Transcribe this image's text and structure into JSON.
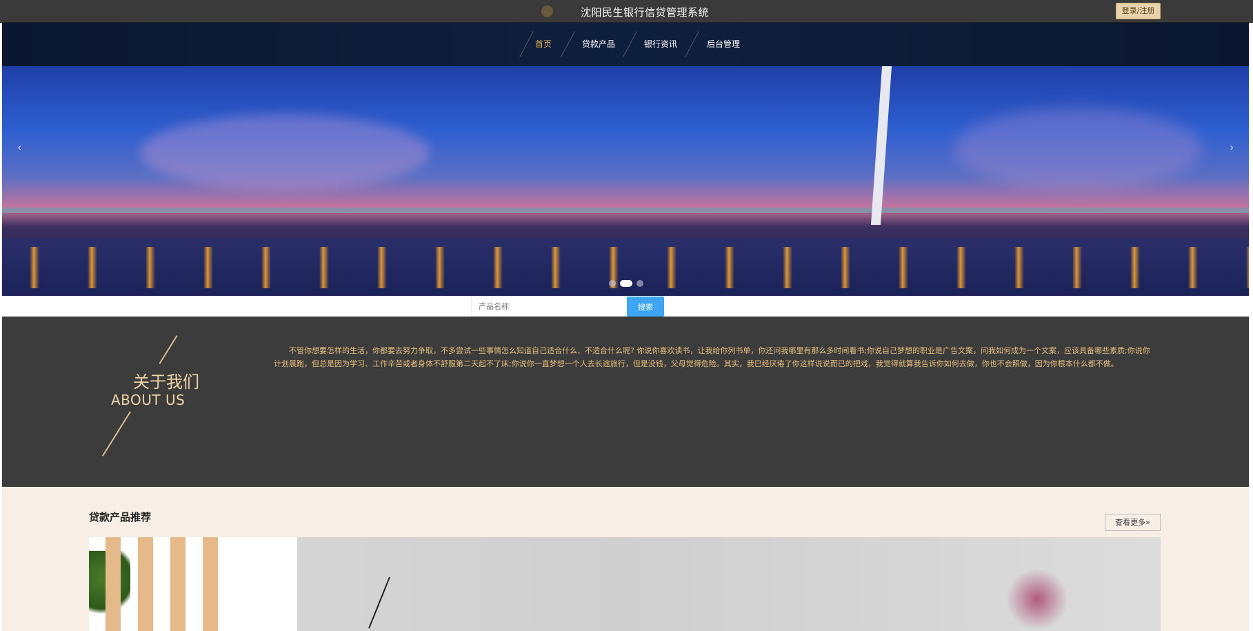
{
  "header": {
    "site_title": "沈阳民生银行信贷管理系统",
    "login_label": "登录/注册"
  },
  "nav": {
    "items": [
      {
        "label": "首页",
        "active": true
      },
      {
        "label": "贷款产品",
        "active": false
      },
      {
        "label": "银行资讯",
        "active": false
      },
      {
        "label": "后台管理",
        "active": false
      }
    ]
  },
  "banner": {
    "prev_icon": "chevron-left-icon",
    "next_icon": "chevron-right-icon",
    "slide_count": 3,
    "active_slide": 2
  },
  "search": {
    "placeholder": "产品名称",
    "button_label": "搜索"
  },
  "about": {
    "title_cn": "关于我们",
    "title_en": "ABOUT US",
    "text": "不管你想要怎样的生活，你都要去努力争取，不多尝试一些事情怎么知道自己适合什么、不适合什么呢? 你说你喜欢读书，让我给你列书单，你还问我哪里有那么多时间看书;你说自己梦想的职业是广告文案，问我如何成为一个文案，应该具备哪些素质;你说你计划晨跑，但总是因为学习、工作辛苦或者身体不舒服第二天起不了床;你说你一直梦想一个人去长途旅行，但是没钱，父母觉得危险。其实，我已经厌倦了你这样说说而已的把戏，我觉得就算我告诉你如何去做，你也不会照做，因为你根本什么都不做。"
  },
  "products": {
    "section_title": "贷款产品推荐",
    "more_label": "查看更多»"
  },
  "colors": {
    "accent_gold": "#e6b15a",
    "search_blue": "#3da5f4",
    "about_bg": "#3c3c3c",
    "products_bg": "#f7efe6"
  }
}
